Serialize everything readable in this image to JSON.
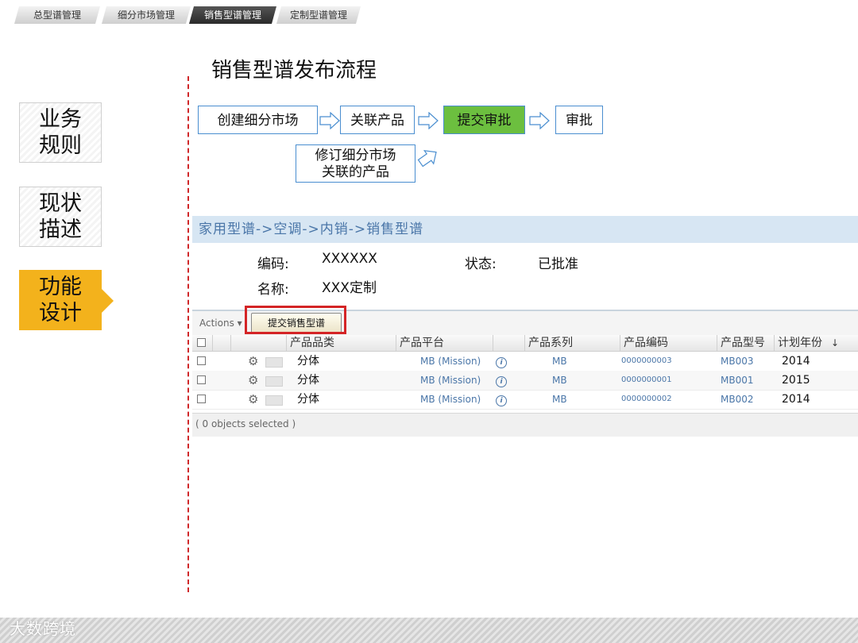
{
  "tabs": [
    "总型谱管理",
    "细分市场管理",
    "销售型谱管理",
    "定制型谱管理"
  ],
  "menu": [
    {
      "label": "业务规则",
      "active": false
    },
    {
      "label": "现状描述",
      "active": false
    },
    {
      "label": "功能设计",
      "active": true
    }
  ],
  "page_title": "销售型谱发布流程",
  "flow": {
    "step1": "创建细分市场",
    "step2": "关联产品",
    "step3": "提交审批",
    "step4": "审批",
    "revise_line1": "修订细分市场",
    "revise_line2": "关联的产品"
  },
  "colors": {
    "accent": "#f3b21c",
    "approve": "#6cbf3f",
    "highlight": "#d42426",
    "divider": "#d0282a"
  },
  "app": {
    "breadcrumb": "家用型谱->空调->内销->销售型谱",
    "code_label": "编码:",
    "code_value": "XXXXXX",
    "status_label": "状态:",
    "status_value": "已批准",
    "name_label": "名称:",
    "name_value": "XXX定制",
    "actions_label": "Actions ▾",
    "submit_button": "提交销售型谱",
    "columns": [
      "产品品类",
      "产品平台",
      "产品系列",
      "产品编码",
      "产品型号",
      "计划年份"
    ],
    "sort_indicator": "↓",
    "rows": [
      {
        "category": "分体",
        "platform": "MB (Mission)",
        "series": "MB",
        "code": "0000000003",
        "model": "MB003",
        "year": "2014"
      },
      {
        "category": "分体",
        "platform": "MB (Mission)",
        "series": "MB",
        "code": "0000000001",
        "model": "MB001",
        "year": "2015"
      },
      {
        "category": "分体",
        "platform": "MB (Mission)",
        "series": "MB",
        "code": "0000000002",
        "model": "MB002",
        "year": "2014"
      }
    ],
    "selection_status": "( 0 objects selected )"
  },
  "watermark": "大数跨境"
}
